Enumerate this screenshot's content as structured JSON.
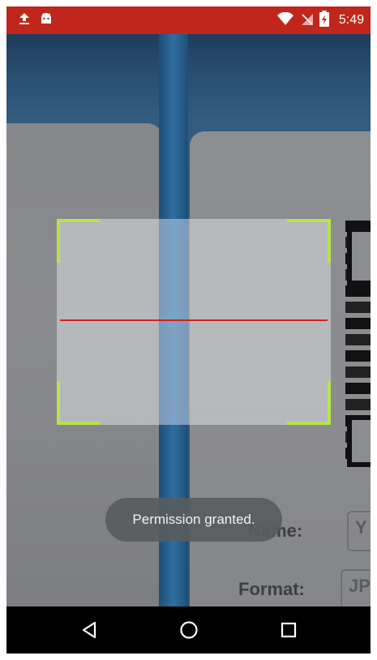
{
  "status_bar": {
    "time": "5:49",
    "left_icons": [
      "upload-icon",
      "android-icon"
    ],
    "right_icons": [
      "wifi-icon",
      "no-sim-icon",
      "battery-charging-icon"
    ],
    "background_color": "#c0261c"
  },
  "scanner": {
    "frame_color": "#b6e44b",
    "laser_color": "#d6201c"
  },
  "camera_preview": {
    "name_label": "Name:",
    "name_value": "Y",
    "format_label": "Format:",
    "format_value": "JP"
  },
  "toast": {
    "message": "Permission granted."
  },
  "nav_bar": {
    "buttons": [
      "back-icon",
      "home-icon",
      "recents-icon"
    ]
  }
}
